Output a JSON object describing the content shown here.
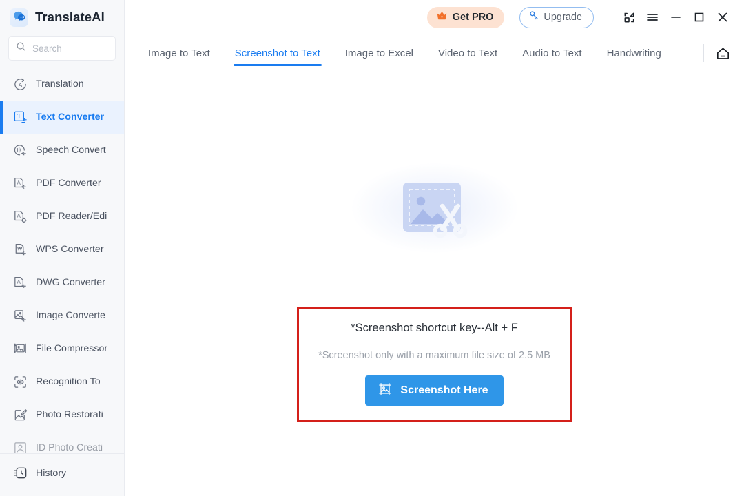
{
  "app": {
    "name": "TranslateAI",
    "logo_icon": "translate-bubble-logo"
  },
  "search": {
    "placeholder": "Search",
    "value": "",
    "icon": "search-icon"
  },
  "sidebar": {
    "items": [
      {
        "label": "Translation",
        "icon": "translate-circle-icon",
        "active": false,
        "truncated": false
      },
      {
        "label": "Text Converter",
        "icon": "text-converter-icon",
        "active": true,
        "truncated": false
      },
      {
        "label": "Speech Convert",
        "icon": "speech-convert-icon",
        "active": false,
        "truncated": false
      },
      {
        "label": "PDF Converter",
        "icon": "pdf-converter-icon",
        "active": false,
        "truncated": false
      },
      {
        "label": "PDF Reader/Edi",
        "icon": "pdf-reader-edit-icon",
        "active": false,
        "truncated": true
      },
      {
        "label": "WPS Converter",
        "icon": "wps-converter-icon",
        "active": false,
        "truncated": false
      },
      {
        "label": "DWG Converter",
        "icon": "dwg-converter-icon",
        "active": false,
        "truncated": false
      },
      {
        "label": "Image Converte",
        "icon": "image-converter-icon",
        "active": false,
        "truncated": true
      },
      {
        "label": "File Compressor",
        "icon": "file-compressor-icon",
        "active": false,
        "truncated": false
      },
      {
        "label": "Recognition To",
        "icon": "recognition-icon",
        "active": false,
        "truncated": true
      },
      {
        "label": "Photo Restorati",
        "icon": "photo-restoration-icon",
        "active": false,
        "truncated": true
      },
      {
        "label": "ID Photo Creati",
        "icon": "id-photo-icon",
        "active": false,
        "truncated": true
      }
    ],
    "footer": {
      "label": "History",
      "icon": "history-clock-icon"
    }
  },
  "titlebar": {
    "get_pro_label": "Get PRO",
    "get_pro_icon": "crown-icon",
    "upgrade_label": "Upgrade",
    "upgrade_icon": "key-icon",
    "collapse_icon": "collapse-to-tray-icon",
    "menu_icon": "hamburger-menu-icon",
    "minimize_icon": "minimize-icon",
    "maximize_icon": "maximize-icon",
    "close_icon": "close-icon"
  },
  "tabs": [
    {
      "label": "Image to Text",
      "active": false
    },
    {
      "label": "Screenshot to Text",
      "active": true
    },
    {
      "label": "Image to Excel",
      "active": false
    },
    {
      "label": "Video to Text",
      "active": false
    },
    {
      "label": "Audio to Text",
      "active": false
    },
    {
      "label": "Handwriting",
      "active": false
    }
  ],
  "tabbar_right": {
    "home_icon": "home-icon"
  },
  "main": {
    "illustration_icon": "screenshot-image-scissors-illustration",
    "hint_title": "*Screenshot shortcut key--Alt + F",
    "hint_subtitle": "*Screenshot only with a maximum file size of 2.5 MB",
    "screenshot_button_label": "Screenshot Here",
    "screenshot_button_icon": "picture-crop-icon"
  },
  "colors": {
    "accent_blue": "#1a7cf0",
    "button_blue": "#2f96e8",
    "highlight_red": "#d4201a",
    "pro_peach": "#fde2d2",
    "crown_orange": "#f2702a",
    "sidebar_bg": "#f7f8fa",
    "illustration_blue": "#c3cff1"
  }
}
